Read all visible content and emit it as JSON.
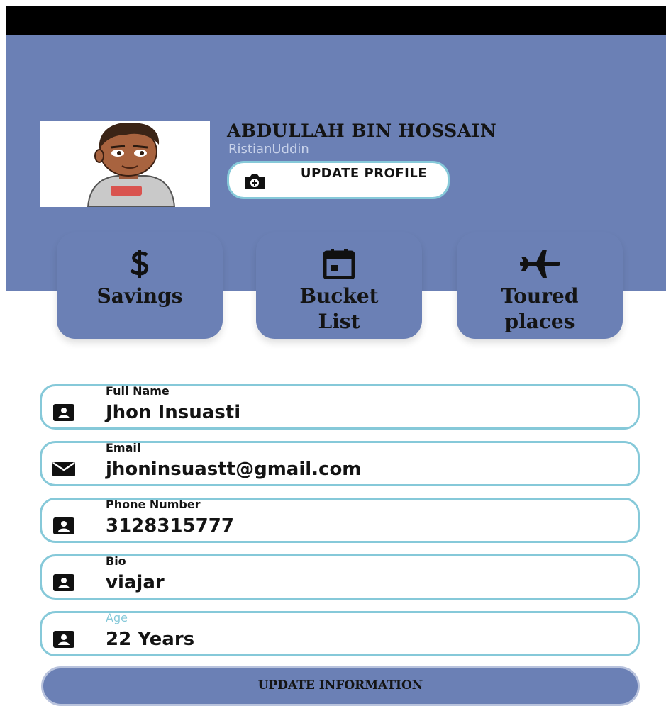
{
  "profile": {
    "name": "ABDULLAH BIN HOSSAIN",
    "handle": "RistianUddin",
    "update_profile_label": "UPDATE PROFILE",
    "avatar_icon": "cartoon-avatar"
  },
  "cards": [
    {
      "label": "Savings",
      "icon": "dollar-icon"
    },
    {
      "label": "Bucket List",
      "icon": "calendar-icon"
    },
    {
      "label": "Toured places",
      "icon": "airplane-icon"
    }
  ],
  "fields": [
    {
      "label": "Full Name",
      "value": "Jhon Insuasti",
      "icon": "contact-card-icon"
    },
    {
      "label": "Email",
      "value": "jhoninsuastt@gmail.com",
      "icon": "email-icon"
    },
    {
      "label": "Phone Number",
      "value": "3128315777",
      "icon": "contact-card-icon"
    },
    {
      "label": "Bio",
      "value": "viajar",
      "icon": "contact-card-icon"
    },
    {
      "label": "Age",
      "value": "22 Years",
      "icon": "contact-card-icon"
    }
  ],
  "update_info_label": "UPDATE INFORMATION",
  "colors": {
    "header": "#6b80b5",
    "accent_border": "#86c9d9",
    "text": "#141414"
  }
}
